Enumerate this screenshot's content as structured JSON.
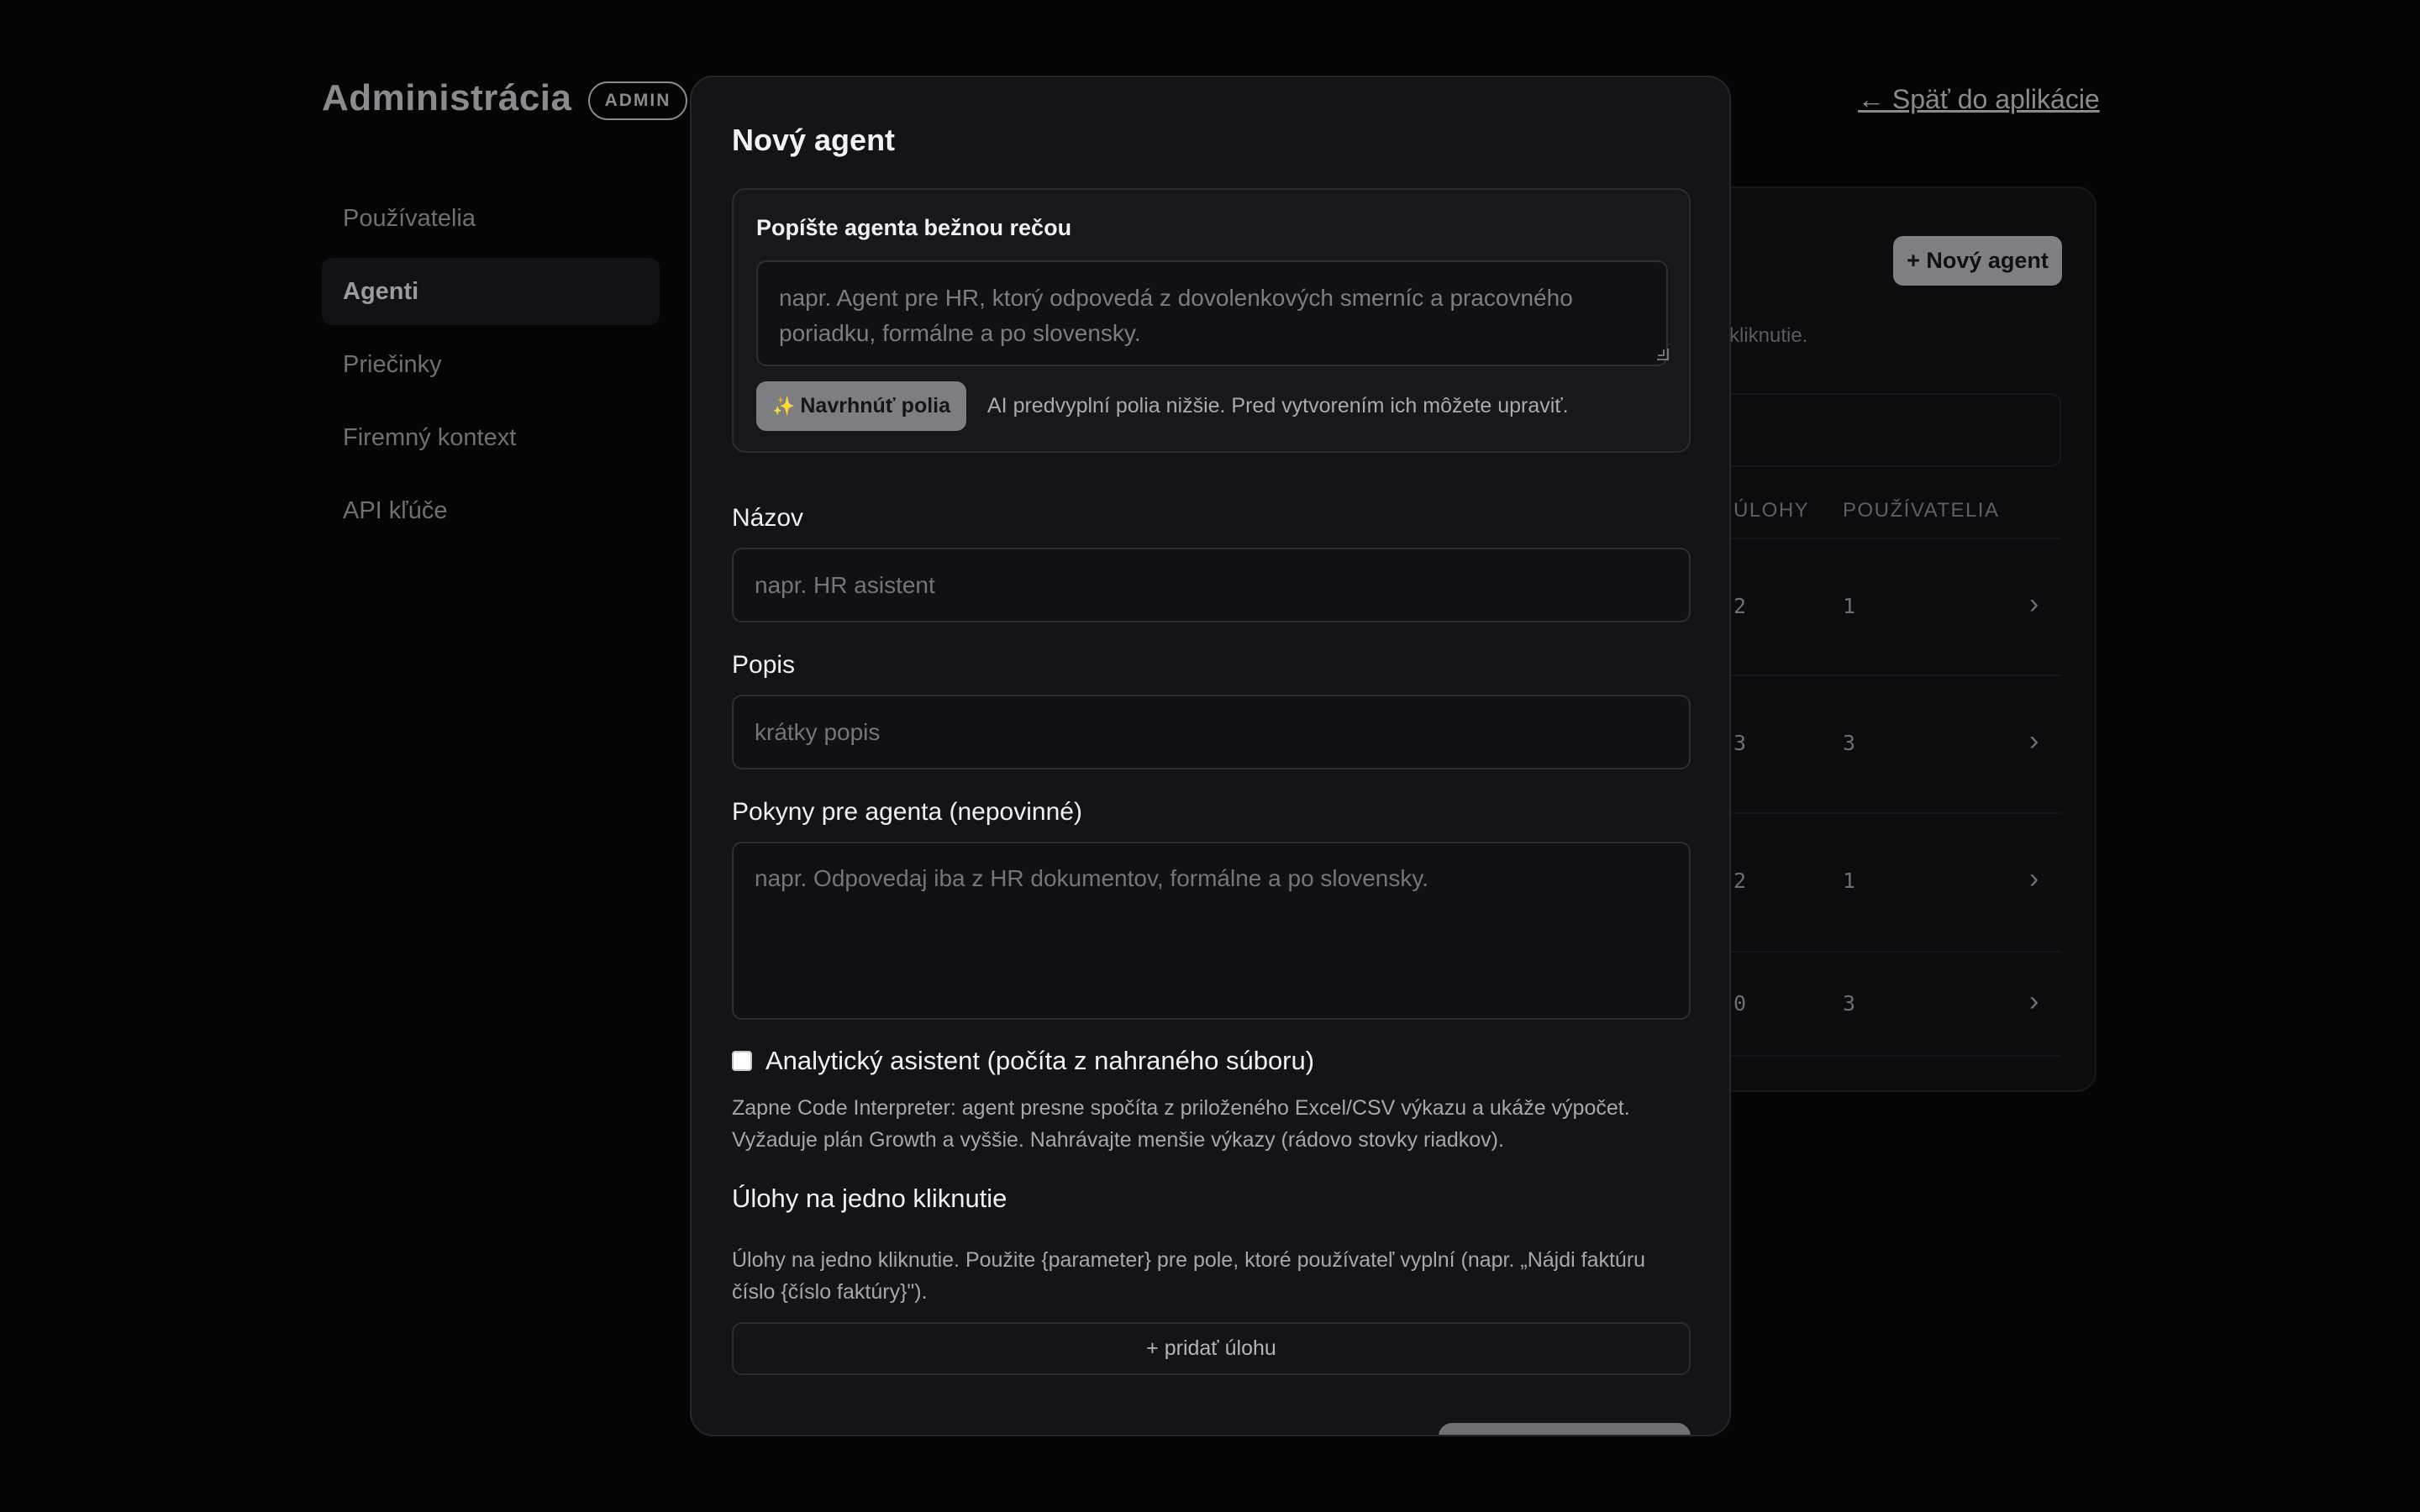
{
  "header": {
    "title": "Administrácia",
    "badge": "ADMIN",
    "back_link": "← Späť do aplikácie"
  },
  "sidebar": {
    "items": [
      {
        "label": "Používatelia",
        "active": false
      },
      {
        "label": "Agenti",
        "active": true
      },
      {
        "label": "Priečinky",
        "active": false
      },
      {
        "label": "Firemný kontext",
        "active": false
      },
      {
        "label": "API kľúče",
        "active": false
      }
    ]
  },
  "background_panel": {
    "new_button": "+ Nový agent",
    "hint_fragment": "kliknutie.",
    "columns": [
      "ÚLOHY",
      "POUŽÍVATELIA"
    ],
    "rows": [
      {
        "tasks": "2",
        "users": "1"
      },
      {
        "tasks": "3",
        "users": "3"
      },
      {
        "tasks": "2",
        "users": "1"
      },
      {
        "tasks": "0",
        "users": "3"
      }
    ]
  },
  "modal": {
    "title": "Nový agent",
    "ai_section": {
      "label": "Popíšte agenta bežnou rečou",
      "placeholder": "napr. Agent pre HR, ktorý odpovedá z dovolenkových smerníc a pracovného poriadku, formálne a po slovensky.",
      "suggest_button": "Navrhnúť polia",
      "note": "AI predvyplní polia nižšie. Pred vytvorením ich môžete upraviť."
    },
    "name": {
      "label": "Názov",
      "placeholder": "napr. HR asistent"
    },
    "description": {
      "label": "Popis",
      "placeholder": "krátky popis"
    },
    "instructions": {
      "label": "Pokyny pre agenta (nepovinné)",
      "placeholder": "napr. Odpovedaj iba z HR dokumentov, formálne a po slovensky."
    },
    "analytics": {
      "label": "Analytický asistent (počíta z nahraného súboru)",
      "checked": false,
      "help": "Zapne Code Interpreter: agent presne spočíta z priloženého Excel/CSV výkazu a ukáže výpočet. Vyžaduje plán Growth a vyššie. Nahrávajte menšie výkazy (rádovo stovky riadkov)."
    },
    "tasks": {
      "title": "Úlohy na jedno kliknutie",
      "help": "Úlohy na jedno kliknutie. Použite {parameter} pre pole, ktoré používateľ vyplní (napr. „Nájdi faktúru číslo {číslo faktúry}\").",
      "add_button": "+ pridať úlohu"
    }
  }
}
